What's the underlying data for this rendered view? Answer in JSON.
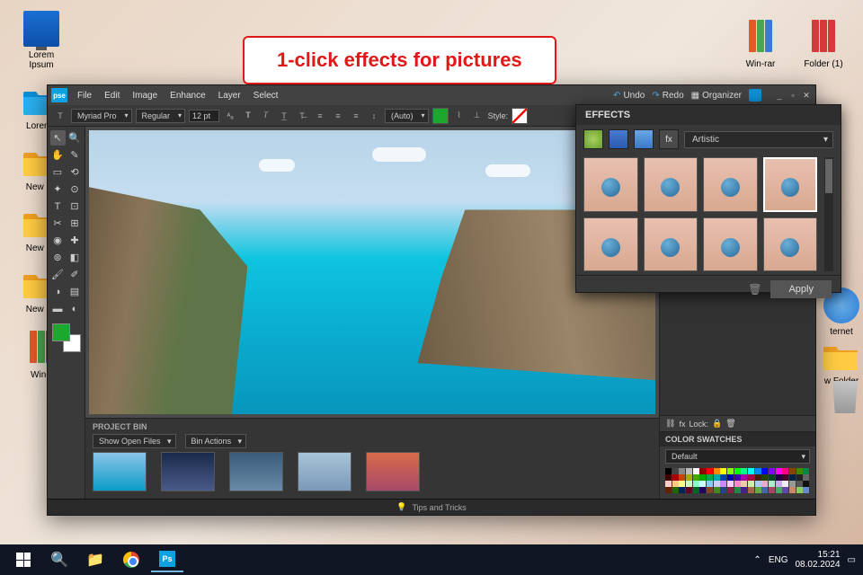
{
  "callout": {
    "text": "1-click effects for pictures"
  },
  "desktop": {
    "icons": [
      {
        "label": "Lorem Ipsum"
      },
      {
        "label": "Lorem I"
      },
      {
        "label": "New Fo"
      },
      {
        "label": "New Fo"
      },
      {
        "label": "New Fo"
      },
      {
        "label": "Win-r"
      },
      {
        "label": "Win-rar"
      },
      {
        "label": "Folder (1)"
      },
      {
        "label": "ternet"
      },
      {
        "label": "w Folder"
      }
    ]
  },
  "app": {
    "logo": "pse",
    "menu": [
      "File",
      "Edit",
      "Image",
      "Enhance",
      "Layer",
      "Select"
    ],
    "title_actions": {
      "undo": "Undo",
      "redo": "Redo",
      "organizer": "Organizer"
    },
    "options": {
      "font": "Myriad Pro",
      "weight": "Regular",
      "size": "12 pt",
      "leading": "(Auto)",
      "style_label": "Style:"
    },
    "project_bin": {
      "title": "PROJECT BIN",
      "show_open": "Show Open Files",
      "bin_actions": "Bin Actions"
    },
    "right": {
      "lock_label": "Lock:",
      "swatches_title": "COLOR SWATCHES",
      "swatches_preset": "Default"
    },
    "status": {
      "tips": "Tips and Tricks"
    }
  },
  "effects": {
    "title": "EFFECTS",
    "category": "Artistic",
    "apply": "Apply"
  },
  "taskbar": {
    "lang": "ENG",
    "time": "15:21",
    "date": "08.02.2024"
  }
}
